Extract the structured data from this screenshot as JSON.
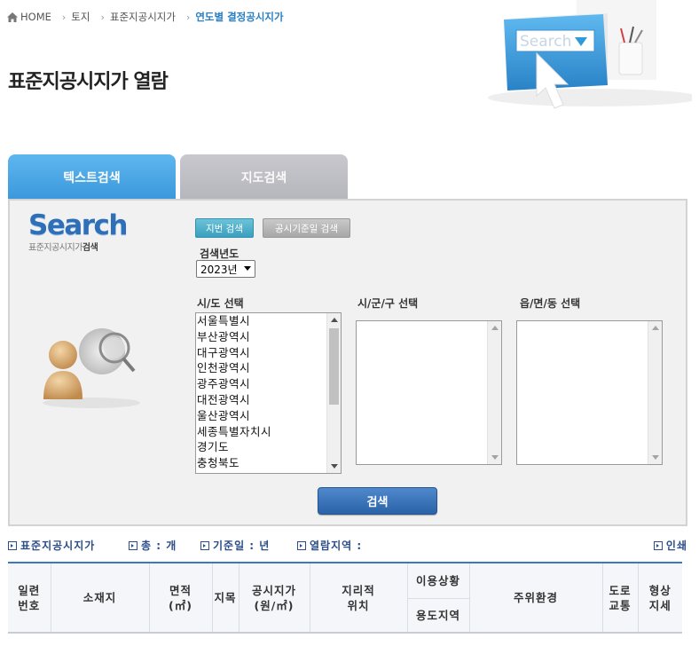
{
  "breadcrumb": {
    "home": "HOME",
    "items": [
      "토지",
      "표준지공시지가"
    ],
    "current": "연도별 결정공시지가"
  },
  "page_title": "표준지공시지가 열람",
  "hero": {
    "search_box_text": "Search"
  },
  "tabs": [
    {
      "label": "텍스트검색",
      "active": true
    },
    {
      "label": "지도검색",
      "active": false
    }
  ],
  "panel": {
    "logo_word": "Search",
    "logo_sub_prefix": "표준지공시지가",
    "logo_sub_bold": "검색",
    "btn_jibun": "지번 검색",
    "btn_date": "공시기준일 검색",
    "year_label": "검색년도",
    "year_value": "2023년",
    "sido_label": "시/도 선택",
    "sigungu_label": "시/군/구 선택",
    "eupmyeon_label": "읍/면/동 선택",
    "sido_options": [
      "서울특별시",
      "부산광역시",
      "대구광역시",
      "인천광역시",
      "광주광역시",
      "대전광역시",
      "울산광역시",
      "세종특별자치시",
      "경기도",
      "충청북도"
    ],
    "search_button": "검색"
  },
  "infobar": {
    "list_title": "표준지공시지가",
    "total": "총 : 개",
    "base_date": "기준일 : 년",
    "region": "열람지역 :",
    "print": "인쇄"
  },
  "table_headers": {
    "serial_1": "일련",
    "serial_2": "번호",
    "location": "소재지",
    "area_1": "면적",
    "area_2": "(㎡)",
    "jimok": "지목",
    "price_1": "공시지가",
    "price_2": "(원/㎡)",
    "geo_1": "지리적",
    "geo_2": "위치",
    "usage": "이용상황",
    "zoning": "용도지역",
    "surroundings": "주위환경",
    "road_1": "도로",
    "road_2": "교통",
    "shape_1": "형상",
    "shape_2": "지세"
  }
}
